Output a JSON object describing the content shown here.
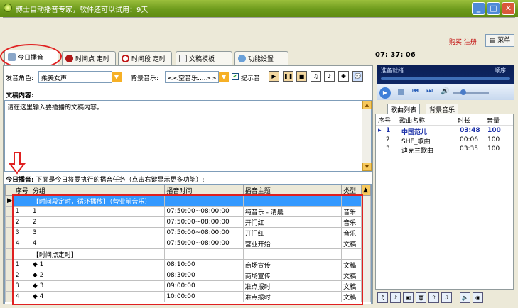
{
  "window": {
    "title": "博士自动播音专家，软件还可以试用：9天"
  },
  "topbar": {
    "buy_register": "购买 注册",
    "menu_label": "菜单"
  },
  "tabs": [
    {
      "label": "今日播音",
      "icon": "speaker-icon"
    },
    {
      "label": "时间点 定时",
      "icon": "alarm-clock-icon"
    },
    {
      "label": "时间段 定时",
      "icon": "clock-icon"
    },
    {
      "label": "文稿模板",
      "icon": "document-icon"
    },
    {
      "label": "功能设置",
      "icon": "gear-icon"
    }
  ],
  "settings": {
    "voice_label": "发音角色:",
    "voice_value": "柔美女声",
    "bgm_label": "背景音乐:",
    "bgm_value": "<<空音乐....>>",
    "prompt_label": "提示音",
    "prompt_checked": true
  },
  "manuscript": {
    "label": "文稿内容:",
    "placeholder": "请在这里输入要插播的文稿内容。"
  },
  "today": {
    "label": "今日播音:",
    "hint": "下面是今日将要执行的播音任务（点击右键显示更多功能）:",
    "columns": [
      "序号",
      "分组",
      "播音时间",
      "播音主题",
      "类型"
    ],
    "rows": [
      {
        "seq": "",
        "group": "【时间段定时，循环播放】（营业前音乐）",
        "time": "",
        "topic": "",
        "type": "",
        "selected": true
      },
      {
        "seq": "1",
        "group": "1",
        "time": "07:50:00~08:00:00",
        "topic": "纯音乐 - 清晨",
        "type": "音乐"
      },
      {
        "seq": "2",
        "group": "2",
        "time": "07:50:00~08:00:00",
        "topic": "开门红",
        "type": "音乐"
      },
      {
        "seq": "3",
        "group": "3",
        "time": "07:50:00~08:00:00",
        "topic": "开门红",
        "type": "音乐"
      },
      {
        "seq": "4",
        "group": "4",
        "time": "07:50:00~08:00:00",
        "topic": "营业开始",
        "type": "文稿"
      },
      {
        "seq": "",
        "group": "【时间点定时】",
        "time": "",
        "topic": "",
        "type": ""
      },
      {
        "seq": "1",
        "group": "◆ 1",
        "time": "08:10:00",
        "topic": "商场宣传",
        "type": "文稿"
      },
      {
        "seq": "2",
        "group": "◆ 2",
        "time": "08:30:00",
        "topic": "商场宣传",
        "type": "文稿"
      },
      {
        "seq": "3",
        "group": "◆ 3",
        "time": "09:00:00",
        "topic": "准点报时",
        "type": "文稿"
      },
      {
        "seq": "4",
        "group": "◆ 4",
        "time": "10:00:00",
        "topic": "准点报时",
        "type": "文稿"
      }
    ]
  },
  "player": {
    "clock": "07: 37: 06",
    "status": "准备就绪",
    "mode": "顺序",
    "tabs": [
      "歌曲列表",
      "背景音乐"
    ],
    "columns": [
      "序号",
      "歌曲名称",
      "时长",
      "音量"
    ],
    "songs": [
      {
        "seq": "1",
        "name": "中国范儿",
        "duration": "03:48",
        "volume": "100",
        "playing": true
      },
      {
        "seq": "2",
        "name": "SHE_歌曲",
        "duration": "00:06",
        "volume": "100"
      },
      {
        "seq": "3",
        "name": "迪克兰歌曲",
        "duration": "03:35",
        "volume": "100"
      }
    ]
  },
  "colors": {
    "titlebar": "#6d9a1c",
    "selection": "#3399ff",
    "highlight_red": "#e02020",
    "accent_blue": "#1a2fa8"
  }
}
